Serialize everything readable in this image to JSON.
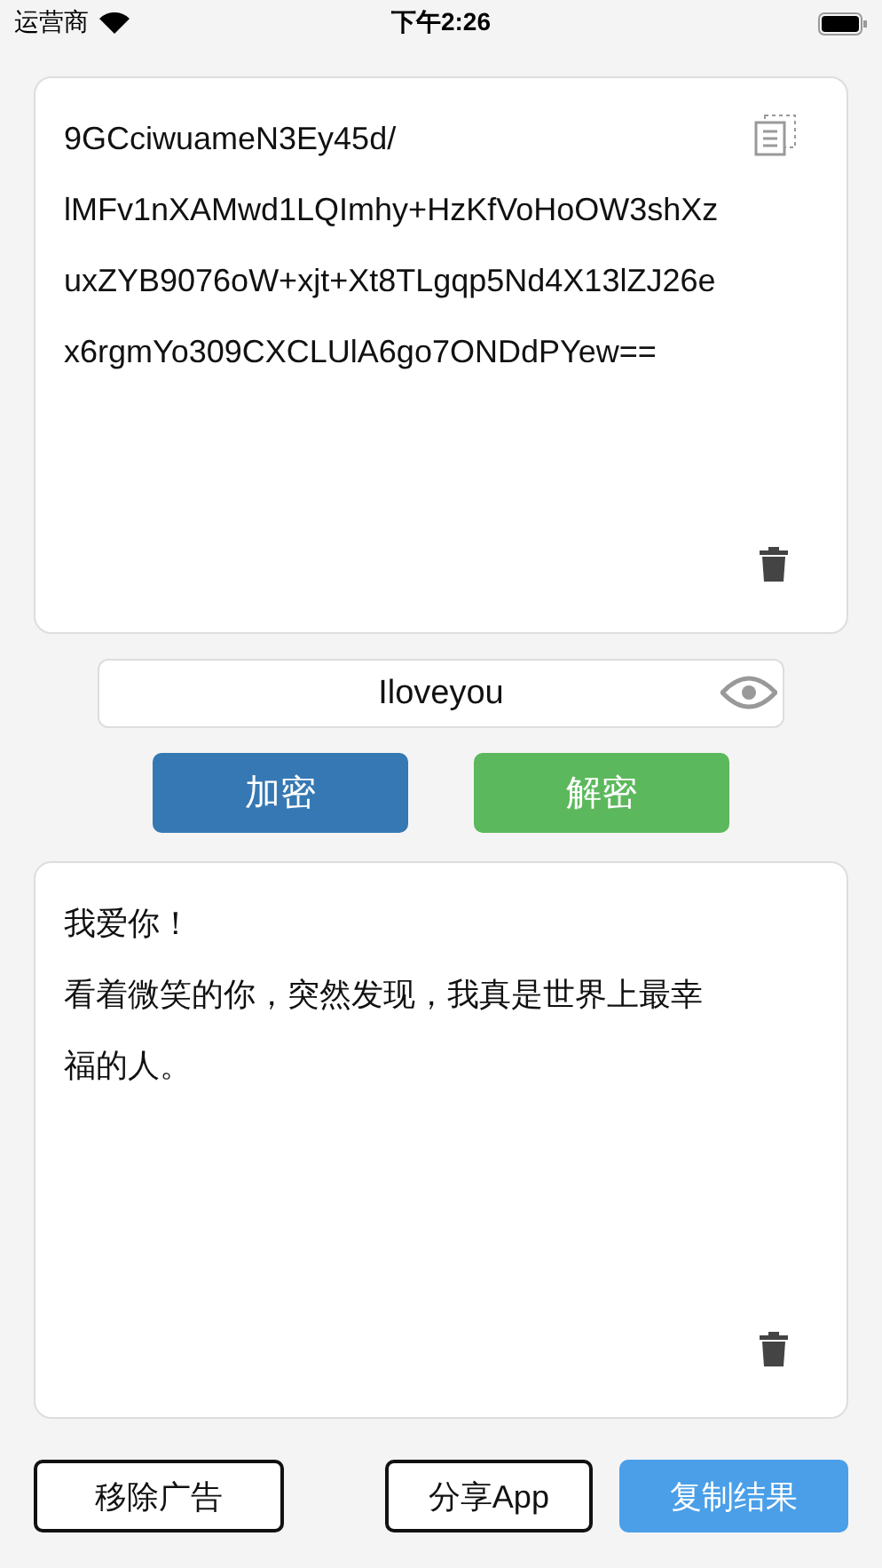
{
  "status_bar": {
    "carrier": "运营商",
    "time": "下午2:26"
  },
  "cipher_box": {
    "lines": [
      "9GCciwuameN3Ey45d/",
      "lMFv1nXAMwd1LQImhy+HzKfVoHoOW3shXz",
      "uxZYB9076oW+xjt+Xt8TLgqp5Nd4X13lZJ26e",
      "x6rgmYo309CXCLUlA6go7ONDdPYew=="
    ]
  },
  "password_field": {
    "value": "Iloveyou",
    "visible": true
  },
  "actions": [
    {
      "label": "加密",
      "kind": "encrypt"
    },
    {
      "label": "解密",
      "kind": "decrypt"
    }
  ],
  "result_box": {
    "lines": [
      "我爱你！",
      "看着微笑的你，突然发现，我真是世界上最幸",
      "福的人。"
    ]
  },
  "footer": [
    {
      "label": "移除广告",
      "kind": "outline"
    },
    {
      "label": "分享App",
      "kind": "outline"
    },
    {
      "label": "复制结果",
      "kind": "primary"
    }
  ]
}
